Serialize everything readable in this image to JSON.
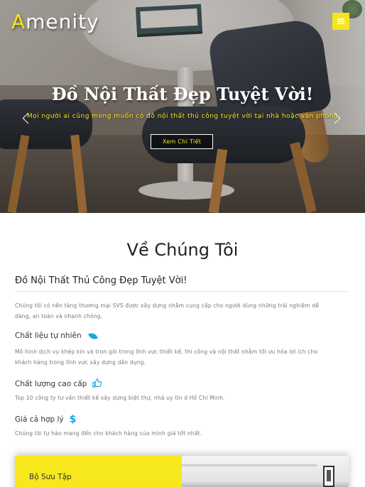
{
  "brand": {
    "first_letter": "A",
    "rest": "menity",
    "accent_color": "#f5e51b"
  },
  "menu_icon": "hamburger-menu-icon",
  "hero": {
    "title": "Đồ Nội Thất Đẹp Tuyệt Vời!",
    "subtitle": "Mọi người ai cũng mong muốn có đồ nội thất thủ công tuyệt vời tại nhà hoặc văn phòng",
    "button_label": "Xem Chi Tiết",
    "prev_icon": "chevron-left-icon",
    "next_icon": "chevron-right-icon"
  },
  "about": {
    "title": "Về Chúng Tôi",
    "heading": "Đồ Nội Thất Thủ Công Đẹp Tuyệt Vời!",
    "intro": "Chúng tôi có nền tảng thương mại SVS được xây dựng nhằm cung cấp cho người dùng những trải nghiệm dễ dàng, an toàn và nhanh chóng.",
    "features": [
      {
        "title": "Chất liệu tự nhiên",
        "icon": "leaf-icon",
        "text": "Mô hình dịch vụ khép kín và trọn gói trong lĩnh vực thiết kế, thi công và nội thất nhằm tối ưu hóa lợi ích cho khách hàng trong lĩnh vực xây dựng dân dụng."
      },
      {
        "title": "Chất lượng cao cấp",
        "icon": "thumbs-up-icon",
        "text": "Top 10 công ty tư vấn thiết kế xây dựng biệt thự, nhà uy tín ở Hồ Chí Minh."
      },
      {
        "title": "Giá cả hợp lý",
        "icon": "dollar-icon",
        "text": "Chúng tôi tự hào mang đến cho khách hàng của mình giá tốt nhất."
      }
    ],
    "icon_color": "#1aa6e0"
  },
  "collection": {
    "label": "Bộ Sưu Tập",
    "color": "#f7e81e"
  }
}
